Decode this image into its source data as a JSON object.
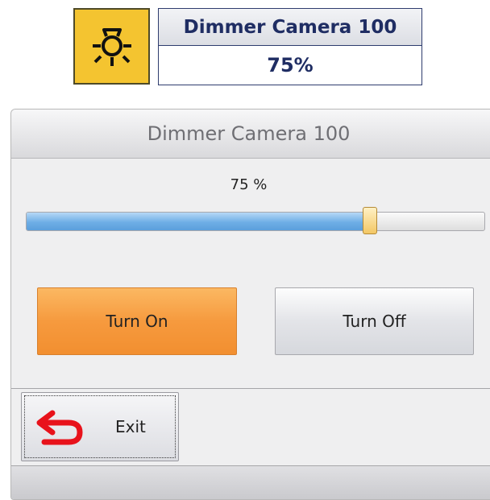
{
  "widget": {
    "icon": "camera-dimmer-icon",
    "title": "Dimmer Camera 100",
    "value": "75%"
  },
  "dialog": {
    "title": "Dimmer Camera 100",
    "level_text": "75 %",
    "slider": {
      "level": 0.75
    },
    "turn_on_label": "Turn On",
    "turn_off_label": "Turn Off",
    "exit_label": "Exit",
    "exit_icon": "undo-arrow-icon"
  },
  "colors": {
    "widget_icon_bg": "#f4c430",
    "widget_text": "#1f2d63",
    "turn_on_bg": "#f69a3e",
    "slider_fill": "#6eaee6",
    "exit_icon": "#e8121b"
  }
}
